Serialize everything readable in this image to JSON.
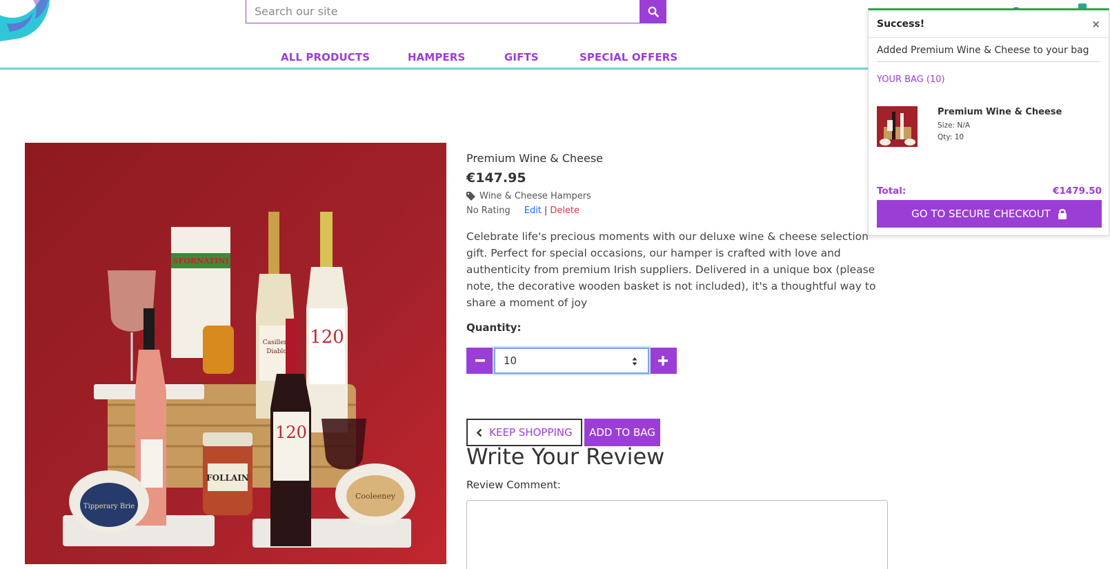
{
  "search": {
    "placeholder": "Search our site"
  },
  "nav": {
    "items": [
      {
        "label": "ALL PRODUCTS"
      },
      {
        "label": "HAMPERS"
      },
      {
        "label": "GIFTS"
      },
      {
        "label": "SPECIAL OFFERS"
      }
    ]
  },
  "product": {
    "name": "Premium Wine & Cheese",
    "price": "€147.95",
    "category": "Wine & Cheese Hampers",
    "rating": "No Rating",
    "edit_label": "Edit",
    "separator": "|",
    "delete_label": "Delete",
    "description": "Celebrate life's precious moments with our deluxe wine & cheese selection gift. Perfect for special occasions, our hamper is crafted with love and authenticity from premium Irish suppliers. Delivered in a unique box (please note, the decorative wooden basket is not included), it's a thoughtful way to share a moment of joy",
    "image_icon": "wine-cheese-hamper-photo"
  },
  "quantity": {
    "label": "Quantity:",
    "value": "10"
  },
  "actions": {
    "keep_shopping": "KEEP SHOPPING",
    "add_to_bag": "ADD TO BAG"
  },
  "review": {
    "title": "Write Your Review",
    "comment_label": "Review Comment:"
  },
  "popup": {
    "title": "Success!",
    "close_icon": "×",
    "message": "Added Premium Wine & Cheese to your bag",
    "bag_label": "YOUR BAG (10)",
    "item": {
      "name": "Premium Wine & Cheese",
      "size": "Size: N/A",
      "qty": "Qty: 10"
    },
    "total_label": "Total:",
    "total_value": "€1479.50",
    "checkout_label": "GO TO SECURE CHECKOUT"
  },
  "colors": {
    "accent": "#9b3ed6",
    "nav_line": "#6fd3e0",
    "success": "#28a745",
    "edit": "#0d6efd",
    "delete": "#dc3545"
  }
}
